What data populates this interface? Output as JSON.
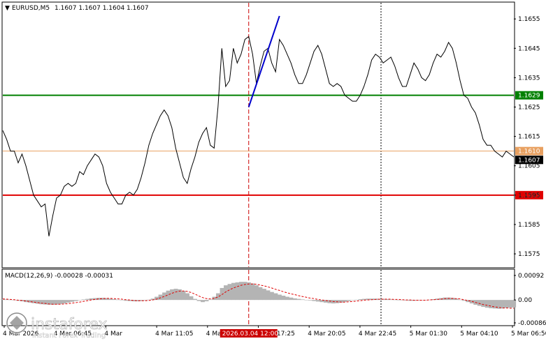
{
  "header": {
    "symbol": "EURUSD,M5",
    "ohlc": "1.1607 1.1607 1.1604 1.1607"
  },
  "colors": {
    "price_line": "#000000",
    "support_line": "#e00000",
    "resistance_line": "#008000",
    "orange_line": "#e8a060",
    "trend_line": "#0000cc",
    "vline_red": "#cc0000",
    "macd_hist": "#b4b4b4",
    "macd_signal": "#e00000"
  },
  "chart_data": [
    {
      "type": "line",
      "symbol": "EURUSD,M5",
      "ylim": [
        1.15705,
        1.16605
      ],
      "y_ticks": [
        "1.1655",
        "1.1645",
        "1.1635",
        "1.1625",
        "1.1615",
        "1.1605",
        "1.1595",
        "1.1585",
        "1.1575"
      ],
      "x_ticks": [
        "4 Mar 2026",
        "4 Mar 06:45",
        "4 Mar",
        "4 Mar 11:05",
        "4 Mar 14:45",
        "4 Mar 17:25",
        "4 Mar 20:05",
        "4 Mar 22:45",
        "5 Mar 01:30",
        "5 Mar 04:10",
        "5 Mar 06:50"
      ],
      "x_highlight": "2026.03.04 12:00",
      "levels": [
        {
          "name": "resistance",
          "value": 1.1629,
          "label": "1.1629"
        },
        {
          "name": "orange",
          "value": 1.161,
          "label": "1.1610"
        },
        {
          "name": "current",
          "value": 1.1607,
          "label": "1.1607"
        },
        {
          "name": "support",
          "value": 1.1595,
          "label": "1.1595"
        }
      ],
      "trendline": {
        "from_index": 64,
        "to_index": 72,
        "from": 1.1625,
        "to": 1.1656
      },
      "values": [
        1.1617,
        1.1614,
        1.161,
        1.161,
        1.1606,
        1.1609,
        1.1605,
        1.16,
        1.1595,
        1.1593,
        1.1591,
        1.1592,
        1.1581,
        1.1588,
        1.1594,
        1.1595,
        1.1598,
        1.1599,
        1.1598,
        1.1599,
        1.1603,
        1.1602,
        1.1605,
        1.1607,
        1.1609,
        1.1608,
        1.1605,
        1.1599,
        1.1596,
        1.1594,
        1.1592,
        1.1592,
        1.1595,
        1.1596,
        1.1595,
        1.1597,
        1.1601,
        1.1606,
        1.1612,
        1.1616,
        1.1619,
        1.1622,
        1.1624,
        1.1622,
        1.1618,
        1.1611,
        1.1606,
        1.1601,
        1.1599,
        1.1604,
        1.1608,
        1.1613,
        1.1616,
        1.1618,
        1.1612,
        1.1611,
        1.1625,
        1.1645,
        1.1632,
        1.1634,
        1.1645,
        1.164,
        1.1643,
        1.1648,
        1.1649,
        1.1643,
        1.1633,
        1.1639,
        1.1644,
        1.1645,
        1.164,
        1.1637,
        1.1648,
        1.1646,
        1.1643,
        1.164,
        1.1636,
        1.1633,
        1.1633,
        1.1636,
        1.164,
        1.1644,
        1.1646,
        1.1643,
        1.1638,
        1.1633,
        1.1632,
        1.1633,
        1.1632,
        1.1629,
        1.1628,
        1.1627,
        1.1627,
        1.1629,
        1.1632,
        1.1636,
        1.1641,
        1.1643,
        1.1642,
        1.164,
        1.1641,
        1.1642,
        1.1639,
        1.1635,
        1.1632,
        1.1632,
        1.1636,
        1.164,
        1.1638,
        1.1635,
        1.1634,
        1.1636,
        1.164,
        1.1643,
        1.1642,
        1.1644,
        1.1647,
        1.1645,
        1.164,
        1.1634,
        1.1629,
        1.1628,
        1.1625,
        1.1623,
        1.1619,
        1.1614,
        1.1612,
        1.1612,
        1.161,
        1.1609,
        1.1608,
        1.161,
        1.1609,
        1.1608
      ]
    },
    {
      "type": "bar",
      "title": "MACD(12,26,9) -0.00028 -0.00031",
      "ylim": [
        -0.00086,
        0.00092
      ],
      "y_ticks": [
        "0.00092",
        "0.00",
        "-0.00086"
      ],
      "series": [
        {
          "name": "histogram",
          "kind": "bar",
          "values": [
            3e-05,
            2e-05,
            1e-05,
            -1e-05,
            -3e-05,
            -5e-05,
            -8e-05,
            -0.0001,
            -0.00012,
            -0.00014,
            -0.00016,
            -0.00017,
            -0.00018,
            -0.00018,
            -0.00017,
            -0.00015,
            -0.00013,
            -0.0001,
            -7e-05,
            -4e-05,
            -1e-05,
            2e-05,
            4e-05,
            6e-05,
            7e-05,
            8e-05,
            8e-05,
            7e-05,
            5e-05,
            3e-05,
            1e-05,
            -1e-05,
            -3e-05,
            -4e-05,
            -5e-05,
            -5e-05,
            -4e-05,
            -2e-05,
            1e-05,
            5e-05,
            0.00012,
            0.0002,
            0.00028,
            0.00035,
            0.0004,
            0.00042,
            0.0004,
            0.00034,
            0.00025,
            0.00014,
            4e-05,
            -4e-05,
            -8e-05,
            -5e-05,
            2e-05,
            0.00012,
            0.00025,
            0.00045,
            0.00055,
            0.0006,
            0.00064,
            0.00066,
            0.00068,
            0.00068,
            0.00066,
            0.00062,
            0.00055,
            0.00048,
            0.00042,
            0.00036,
            0.0003,
            0.00025,
            0.0002,
            0.00016,
            0.00012,
            9e-05,
            6e-05,
            4e-05,
            2e-05,
            0,
            -2e-05,
            -4e-05,
            -6e-05,
            -8e-05,
            -0.0001,
            -0.00012,
            -0.00013,
            -0.00012,
            -0.0001,
            -7e-05,
            -4e-05,
            -1e-05,
            1e-05,
            3e-05,
            4e-05,
            5e-05,
            5e-05,
            5e-05,
            4e-05,
            4e-05,
            3e-05,
            2e-05,
            1e-05,
            0,
            -1e-05,
            -2e-05,
            -3e-05,
            -3e-05,
            -2e-05,
            -1e-05,
            0,
            1e-05,
            3e-05,
            5e-05,
            7e-05,
            9e-05,
            9e-05,
            8e-05,
            5e-05,
            1e-05,
            -3e-05,
            -8e-05,
            -0.00013,
            -0.00018,
            -0.00022,
            -0.00026,
            -0.00029,
            -0.00031,
            -0.00032,
            -0.00033,
            -0.00032,
            -0.0003,
            -0.00029,
            -0.00028
          ]
        },
        {
          "name": "signal",
          "kind": "line",
          "values": [
            4e-05,
            3e-05,
            2e-05,
            1e-05,
            -1e-05,
            -2e-05,
            -4e-05,
            -6e-05,
            -8e-05,
            -0.0001,
            -0.00012,
            -0.00013,
            -0.00015,
            -0.00016,
            -0.00016,
            -0.00016,
            -0.00015,
            -0.00014,
            -0.00012,
            -0.0001,
            -8e-05,
            -5e-05,
            -3e-05,
            0,
            2e-05,
            4e-05,
            5e-05,
            6e-05,
            6e-05,
            5e-05,
            4e-05,
            3e-05,
            1e-05,
            0,
            -2e-05,
            -3e-05,
            -3e-05,
            -3e-05,
            -2e-05,
            0,
            3e-05,
            8e-05,
            0.00013,
            0.00019,
            0.00025,
            0.0003,
            0.00033,
            0.00034,
            0.00032,
            0.00028,
            0.00022,
            0.00015,
            9e-05,
            5e-05,
            4e-05,
            6e-05,
            0.00011,
            0.0002,
            0.0003,
            0.00038,
            0.00045,
            0.0005,
            0.00055,
            0.00058,
            0.0006,
            0.0006,
            0.00059,
            0.00056,
            0.00053,
            0.00049,
            0.00045,
            0.0004,
            0.00036,
            0.00031,
            0.00027,
            0.00023,
            0.0002,
            0.00016,
            0.00013,
            0.0001,
            7e-05,
            5e-05,
            2e-05,
            0,
            -2e-05,
            -4e-05,
            -6e-05,
            -7e-05,
            -8e-05,
            -8e-05,
            -7e-05,
            -6e-05,
            -4e-05,
            -3e-05,
            -1e-05,
            0,
            1e-05,
            2e-05,
            3e-05,
            3e-05,
            3e-05,
            3e-05,
            2e-05,
            2e-05,
            1e-05,
            0,
            0,
            -1e-05,
            -1e-05,
            -1e-05,
            -1e-05,
            0,
            1e-05,
            2e-05,
            3e-05,
            5e-05,
            6e-05,
            6e-05,
            5e-05,
            4e-05,
            1e-05,
            -2e-05,
            -5e-05,
            -9e-05,
            -0.00013,
            -0.00017,
            -0.0002,
            -0.00023,
            -0.00026,
            -0.00028,
            -0.0003,
            -0.0003,
            -0.00031,
            -0.00031
          ]
        }
      ]
    }
  ],
  "watermark": {
    "brand": "instaforex",
    "tagline": "Instant Forex Trading"
  }
}
